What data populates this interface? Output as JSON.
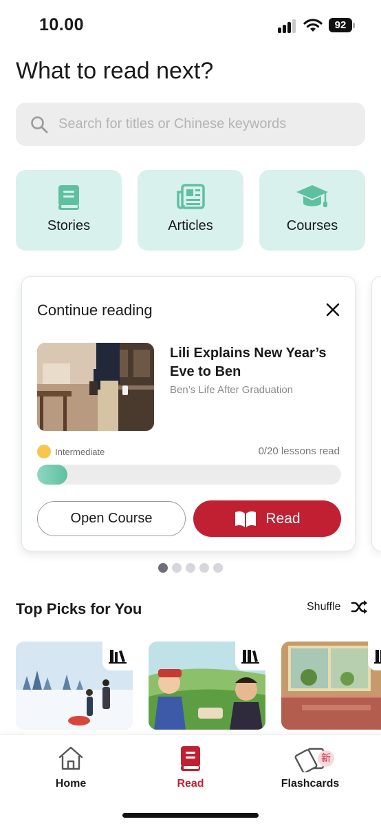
{
  "status_bar": {
    "time": "10.00",
    "battery": "92",
    "icons": [
      "cellular-signal-icon",
      "wifi-icon",
      "battery-icon"
    ]
  },
  "header": {
    "title": "What to read next?"
  },
  "search": {
    "placeholder": "Search for titles or Chinese keywords",
    "value": "",
    "icon": "search-icon"
  },
  "categories": [
    {
      "label": "Stories",
      "icon": "book-icon"
    },
    {
      "label": "Articles",
      "icon": "newspaper-icon"
    },
    {
      "label": "Courses",
      "icon": "graduation-cap-icon"
    }
  ],
  "continue_reading": {
    "heading": "Continue reading",
    "close_icon": "close-icon",
    "title": "Lili Explains New Year’s Eve to Ben",
    "subtitle": "Ben’s Life After Graduation",
    "level": "Intermediate",
    "lessons_read": "0/20 lessons read",
    "progress_fraction": 0,
    "open_course_label": "Open Course",
    "read_label": "Read",
    "read_icon": "open-book-icon"
  },
  "carousel": {
    "pages": 5,
    "active_index": 0
  },
  "top_picks": {
    "title": "Top Picks for You",
    "shuffle_label": "Shuffle",
    "shuffle_icon": "shuffle-icon",
    "items": [
      {
        "badge_icon": "books-icon"
      },
      {
        "badge_icon": "books-icon"
      },
      {
        "badge_icon": "books-icon"
      }
    ]
  },
  "nav": {
    "items": [
      {
        "label": "Home",
        "icon": "home-icon",
        "active": false
      },
      {
        "label": "Read",
        "icon": "book-icon",
        "active": true
      },
      {
        "label": "Flashcards",
        "icon": "flashcards-icon",
        "active": false,
        "badge": "新"
      }
    ]
  },
  "colors": {
    "accent_red": "#c12032",
    "tile_mint": "#d8f1ec",
    "icon_teal": "#5fc09f",
    "level_yellow": "#f8c64d"
  }
}
